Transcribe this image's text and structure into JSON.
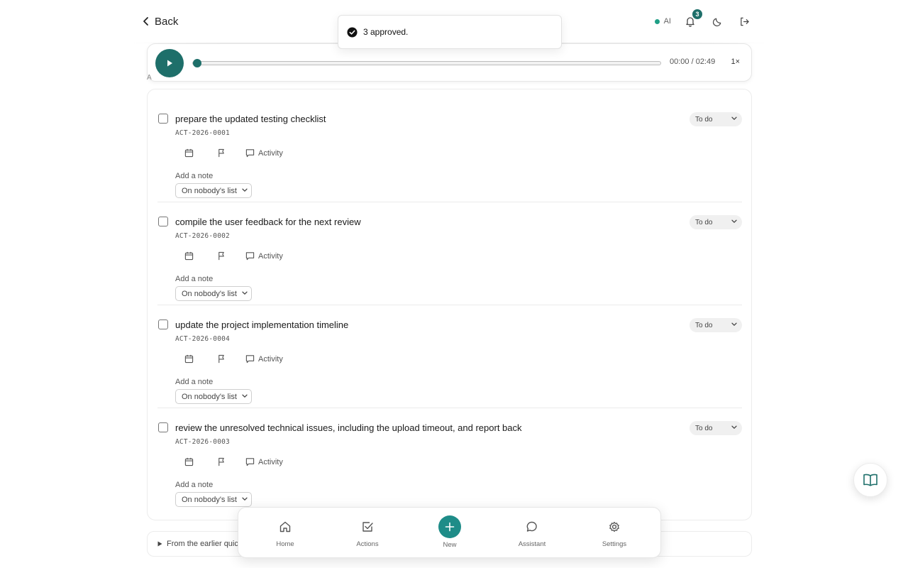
{
  "header": {
    "back_label": "Back",
    "ai_label": "AI",
    "notifications_count": "3"
  },
  "toast": {
    "message": "3 approved."
  },
  "player": {
    "time": "00:00 / 02:49",
    "speed": "1×",
    "progress": 0
  },
  "stray_text": "A",
  "actions": [
    {
      "title": "prepare the updated testing checklist",
      "code": "ACT-2026-0001",
      "status": "To do",
      "activity_label": "Activity",
      "note_label": "Add a note",
      "list_value": "On nobody's list"
    },
    {
      "title": "compile the user feedback for the next review",
      "code": "ACT-2026-0002",
      "status": "To do",
      "activity_label": "Activity",
      "note_label": "Add a note",
      "list_value": "On nobody's list"
    },
    {
      "title": "update the project implementation timeline",
      "code": "ACT-2026-0004",
      "status": "To do",
      "activity_label": "Activity",
      "note_label": "Add a note",
      "list_value": "On nobody's list"
    },
    {
      "title": "review the unresolved technical issues, including the upload timeout, and report back",
      "code": "ACT-2026-0003",
      "status": "To do",
      "activity_label": "Activity",
      "note_label": "Add a note",
      "list_value": "On nobody's list"
    }
  ],
  "earlier_section": {
    "label": "From the earlier quic"
  },
  "bottom_nav": {
    "items": [
      {
        "label": "Home",
        "icon": "home-icon"
      },
      {
        "label": "Actions",
        "icon": "checkbox-icon"
      },
      {
        "label": "New",
        "icon": "plus-icon"
      },
      {
        "label": "Assistant",
        "icon": "chat-bubble-icon"
      },
      {
        "label": "Settings",
        "icon": "gear-icon"
      }
    ]
  },
  "colors": {
    "accent": "#1e6f6a",
    "new_button": "#1e8c88",
    "ai_dot": "#1f9f86"
  }
}
